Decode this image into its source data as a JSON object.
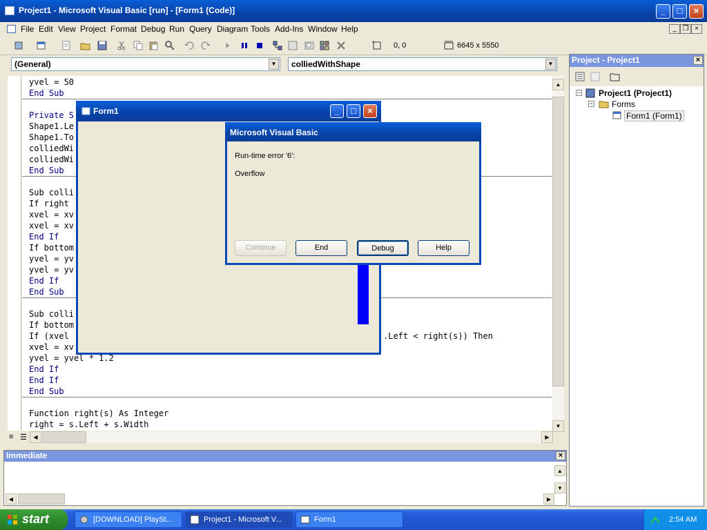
{
  "window": {
    "title": "Project1 - Microsoft Visual Basic [run] - [Form1 (Code)]"
  },
  "menu": [
    "File",
    "Edit",
    "View",
    "Project",
    "Format",
    "Debug",
    "Run",
    "Query",
    "Diagram",
    "Tools",
    "Add-Ins",
    "Window",
    "Help"
  ],
  "toolbar": {
    "position": "0, 0",
    "size": "6645 x 5550"
  },
  "code": {
    "object_combo": "(General)",
    "proc_combo": "colliedWithShape",
    "lines": [
      "yvel = 50",
      "End Sub",
      "Private S",
      "Shape1.Le",
      "Shape1.To",
      "colliedWi",
      "colliedWi",
      "End Sub",
      "Sub colli",
      "If right",
      "xvel = xv",
      "xvel = xv",
      "End If",
      "If bottom",
      "yvel = yv",
      "yvel = yv",
      "End If",
      "End Sub",
      "Sub colli",
      "If bottom",
      "If (xvel",
      "xvel = xv",
      "yvel = yvel * 1.2",
      "End If",
      "End If",
      "End Sub",
      "Function right(s) As Integer",
      "right = s.Left + s.Width"
    ],
    "right_fragment": ".Left < right(s)) Then"
  },
  "project": {
    "title": "Project - Project1",
    "root": "Project1 (Project1)",
    "folder": "Forms",
    "item": "Form1 (Form1)"
  },
  "immediate": {
    "title": "Immediate"
  },
  "form1": {
    "title": "Form1"
  },
  "dialog": {
    "title": "Microsoft Visual Basic",
    "error": "Run-time error '6':",
    "message": "Overflow",
    "buttons": [
      "Continue",
      "End",
      "Debug",
      "Help"
    ]
  },
  "taskbar": {
    "start": "start",
    "tasks": [
      "[DOWNLOAD] PlaySt...",
      "Project1 - Microsoft V...",
      "Form1"
    ],
    "clock": "2:54 AM"
  },
  "colors": {
    "title_blue": "#0a47b8",
    "panel_header": "#7a96df",
    "shape_fill": "#0000ff",
    "taskbar": "#245edb"
  }
}
